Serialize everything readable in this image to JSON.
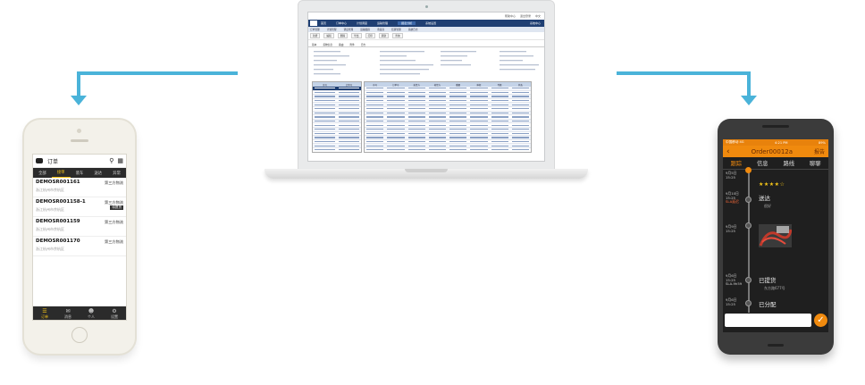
{
  "colors": {
    "connector": "#4ab3d9",
    "accent_orange": "#f08a0e",
    "accent_yellow": "#f5c518",
    "nav_blue": "#1f3f73"
  },
  "mobile_ios": {
    "header_title": "订单",
    "search_icon": "search-icon",
    "scan_icon": "scan-icon",
    "tabs": [
      {
        "label": "全部",
        "active": false
      },
      {
        "label": "接单",
        "active": true
      },
      {
        "label": "装车",
        "active": false
      },
      {
        "label": "送达",
        "active": false
      },
      {
        "label": "异常",
        "active": false
      }
    ],
    "orders": [
      {
        "id": "DEMOSR001161",
        "carrier": "第三方物流",
        "sub": "浙江杭州市余杭区",
        "badge": ""
      },
      {
        "id": "DEMOSR001158-1",
        "carrier": "第三方物流",
        "sub": "浙江杭州市余杭区",
        "badge": "待提货"
      },
      {
        "id": "DEMOSR001159",
        "carrier": "第三方物流",
        "sub": "浙江杭州市余杭区",
        "badge": ""
      },
      {
        "id": "DEMOSR001170",
        "carrier": "第三方物流",
        "sub": "浙江杭州市余杭区",
        "badge": ""
      }
    ],
    "footer": [
      {
        "icon": "list-icon",
        "label": "订单",
        "active": true
      },
      {
        "icon": "megaphone-icon",
        "label": "消息",
        "active": false
      },
      {
        "icon": "user-icon",
        "label": "个人",
        "active": false
      },
      {
        "icon": "gear-icon",
        "label": "设置",
        "active": false
      }
    ]
  },
  "desktop": {
    "top_links": [
      "帮助中心",
      "退出登录",
      "中文"
    ],
    "nav": [
      {
        "label": "首页",
        "active": false
      },
      {
        "label": "订单中心",
        "active": false
      },
      {
        "label": "计划调度",
        "active": false
      },
      {
        "label": "运输管理",
        "active": false
      },
      {
        "label": "报表分析",
        "active": true
      },
      {
        "label": "系统设置",
        "active": false
      }
    ],
    "nav_right": "系统中心",
    "sub_nav": [
      "订单管理",
      "计划管理",
      "调度管理",
      "运输跟踪",
      "承运商",
      "结算管理",
      "系统日志"
    ],
    "toolbar": [
      "新增",
      "编辑",
      "删除",
      "导出",
      "打印",
      "刷新",
      "查询"
    ],
    "tabs": [
      "基本",
      "货物信息",
      "路由",
      "附件",
      "日志"
    ],
    "table_headers_left": [
      "序号",
      "订单号"
    ],
    "table_headers_right": [
      "序号",
      "订单号",
      "发货方",
      "收货方",
      "重量",
      "体积",
      "件数",
      "状态"
    ]
  },
  "mobile_android": {
    "status_left": "中国移动 4G",
    "status_time": "4:21 PM",
    "status_right": "89%",
    "title": "Order00012a",
    "back_icon": "back-arrow-icon",
    "action": "报告",
    "tabs": [
      {
        "label": "跟踪",
        "active": true
      },
      {
        "label": "信息",
        "active": false
      },
      {
        "label": "路线",
        "active": false
      },
      {
        "label": "聊聊",
        "active": false
      }
    ],
    "rating_stars": 4,
    "timeline": [
      {
        "date": "9月5日",
        "time": "15:25",
        "extra": "",
        "title": "",
        "note": ""
      },
      {
        "date": "9月10日",
        "time": "15:25",
        "extra": "SLA延迟",
        "title": "送达",
        "note": "很好"
      },
      {
        "date": "9月9日",
        "time": "15:25",
        "extra": "",
        "title": "",
        "note": ""
      },
      {
        "date": "9月6日",
        "time": "15:25",
        "extra": "SLA-9h59",
        "title": "已提货",
        "note": "东方路677号"
      },
      {
        "date": "9月6日",
        "time": "15:25",
        "extra": "",
        "title": "已分配",
        "note": ""
      }
    ],
    "send_icon": "check-icon"
  }
}
